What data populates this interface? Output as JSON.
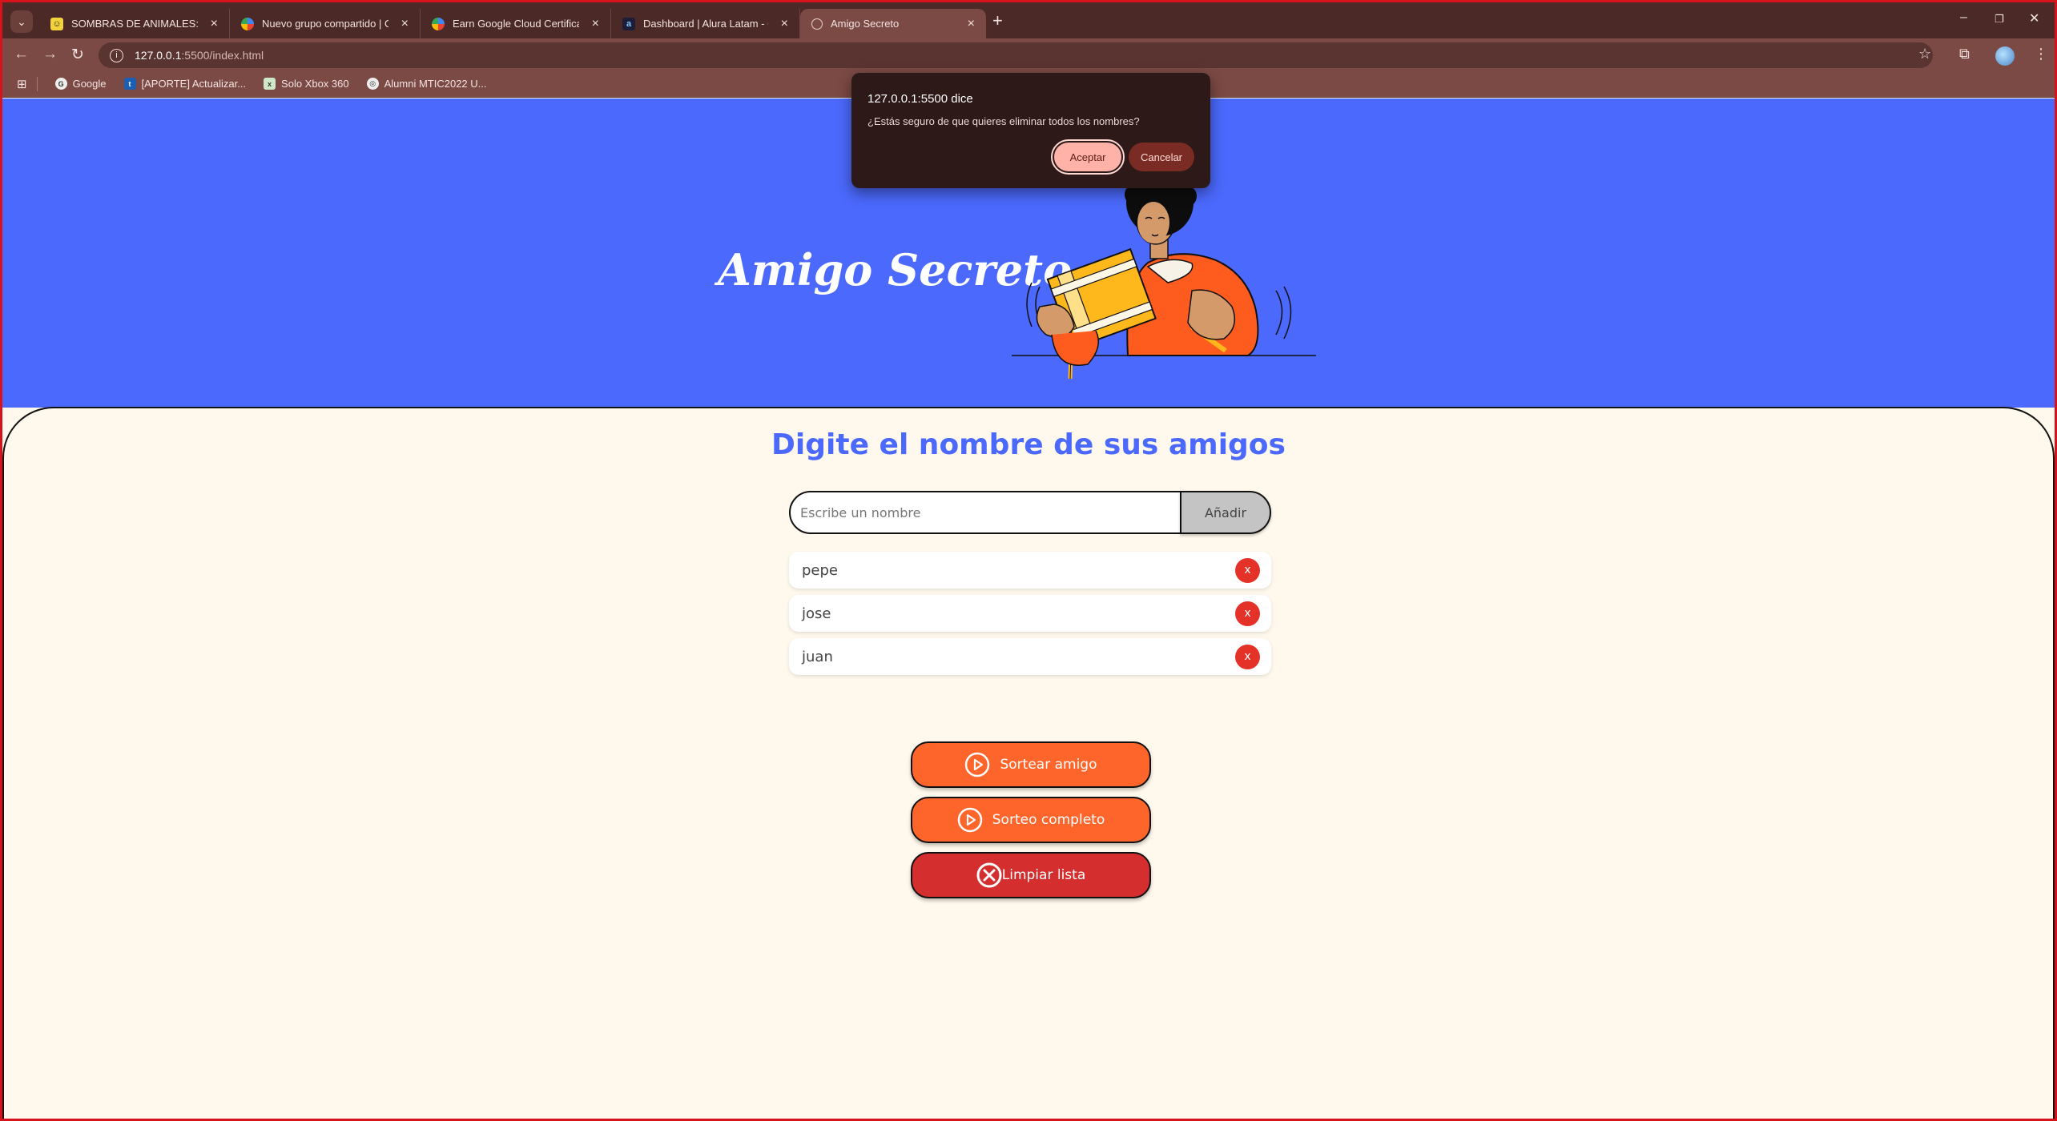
{
  "browser": {
    "tabs": [
      {
        "title": "SOMBRAS DE ANIMALES: Cont",
        "favicon": "sombras-favicon",
        "active": false
      },
      {
        "title": "Nuevo grupo compartido | Goo",
        "favicon": "google-cloud-favicon",
        "active": false
      },
      {
        "title": "Earn Google Cloud Certification",
        "favicon": "google-cloud-favicon",
        "active": false
      },
      {
        "title": "Dashboard | Alura Latam - Curs",
        "favicon": "alura-favicon",
        "active": false
      },
      {
        "title": "Amigo Secreto",
        "favicon": "globe-favicon",
        "active": true
      }
    ],
    "url_host": "127.0.0.1",
    "url_path": ":5500/index.html",
    "bookmarks": [
      {
        "label": "Google",
        "icon": "google-icon"
      },
      {
        "label": "[APORTE] Actualizar...",
        "icon": "aporte-icon"
      },
      {
        "label": "Solo Xbox 360",
        "icon": "xbox-icon"
      },
      {
        "label": "Alumni MTIC2022 U...",
        "icon": "alumni-icon"
      }
    ]
  },
  "dialog": {
    "title": "127.0.0.1:5500 dice",
    "message": "¿Estás seguro de que quieres eliminar todos los nombres?",
    "accept_label": "Aceptar",
    "cancel_label": "Cancelar"
  },
  "app": {
    "title": "Amigo Secreto",
    "section_title": "Digite el nombre de sus amigos",
    "input_placeholder": "Escribe un nombre",
    "input_value": "",
    "add_label": "Añadir",
    "friends": [
      {
        "name": "pepe",
        "remove_label": "x"
      },
      {
        "name": "jose",
        "remove_label": "x"
      },
      {
        "name": "juan",
        "remove_label": "x"
      }
    ],
    "actions": {
      "draw_label": "Sortear amigo",
      "full_draw_label": "Sorteo completo",
      "clear_label": "Limpiar lista"
    }
  },
  "colors": {
    "banner": "#4b69fd",
    "background": "#fff8ec",
    "accent_orange": "#fe652b",
    "danger_red": "#d42e2e",
    "remove_red": "#e53228"
  }
}
